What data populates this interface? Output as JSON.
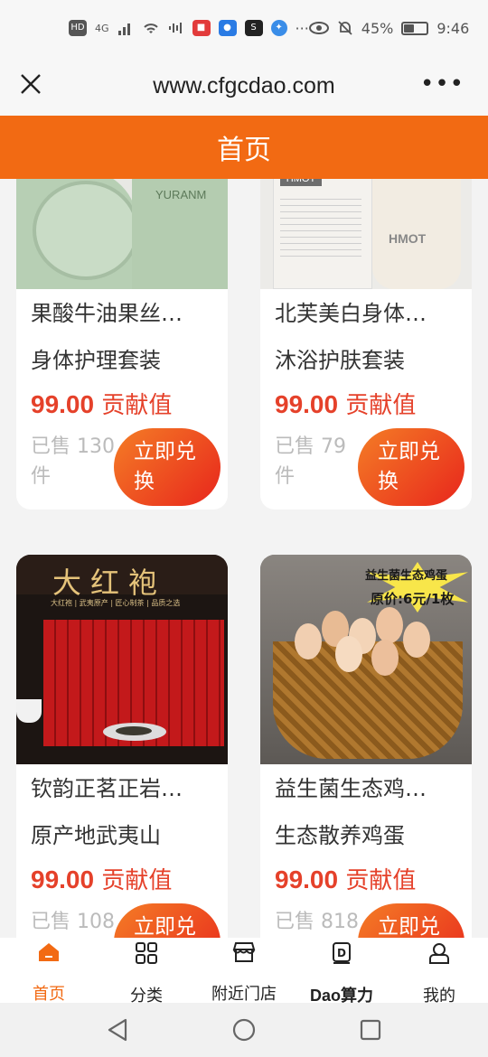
{
  "status_bar": {
    "left_text": "HD",
    "signal_label": "4G",
    "eye_icon": "eye-icon",
    "battery": "45%",
    "time": "9:46",
    "battery_level": 0.45
  },
  "browser": {
    "url": "www.cfgcdao.com",
    "close_icon": "close-icon",
    "more_icon": "more-icon",
    "more_text": "•••"
  },
  "header": {
    "title": "首页"
  },
  "products": [
    {
      "name": "果酸牛油果丝…",
      "subtitle": "身体护理套装",
      "price_value": "99.00",
      "price_unit": "贡献值",
      "sold": "已售 130件",
      "button": "立即兑换",
      "image_text": "YURANM"
    },
    {
      "name": "北芙美白身体…",
      "subtitle": "沐浴护肤套装",
      "price_value": "99.00",
      "price_unit": "贡献值",
      "sold": "已售 79件",
      "button": "立即兑换",
      "image_text": "HMOT"
    },
    {
      "name": "钦韵正茗正岩…",
      "subtitle": "原产地武夷山",
      "price_value": "99.00",
      "price_unit": "贡献值",
      "sold": "已售 108",
      "button": "立即兑",
      "image_text": "大红袍",
      "image_subtext": "大红袍 | 武夷原产 | 匠心制茶 | 品质之选"
    },
    {
      "name": "益生菌生态鸡…",
      "subtitle": "生态散养鸡蛋",
      "price_value": "99.00",
      "price_unit": "贡献值",
      "sold": "已售 818",
      "button": "立即兑",
      "image_text": "益生菌生态鸡蛋",
      "image_subtext": "原价:6元/1枚"
    }
  ],
  "tabs": [
    {
      "label": "首页",
      "icon": "home-icon",
      "active": true
    },
    {
      "label": "分类",
      "icon": "category-grid-icon",
      "active": false
    },
    {
      "label": "附近门店",
      "icon": "store-icon",
      "active": false
    },
    {
      "label": "Dao算力",
      "icon": "dao-icon",
      "active": false
    },
    {
      "label": "我的",
      "icon": "profile-icon",
      "active": false
    }
  ],
  "colors": {
    "accent": "#f26a13",
    "price": "#e5412a",
    "button_gradient_start": "#f47d26",
    "button_gradient_end": "#e8261c"
  }
}
